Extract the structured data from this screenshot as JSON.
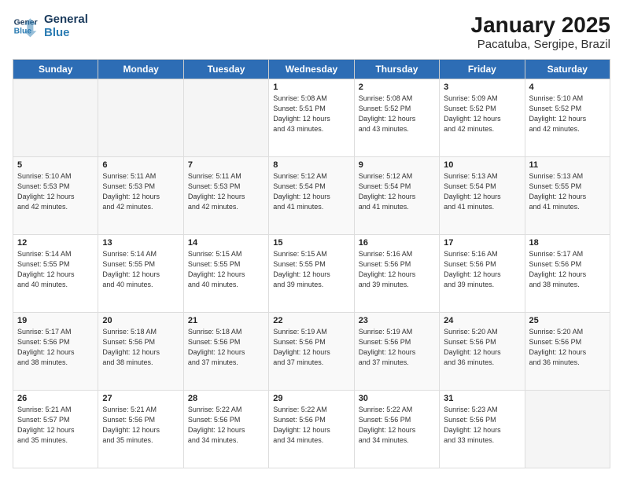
{
  "app": {
    "logo_line1": "General",
    "logo_line2": "Blue"
  },
  "header": {
    "title": "January 2025",
    "subtitle": "Pacatuba, Sergipe, Brazil"
  },
  "weekdays": [
    "Sunday",
    "Monday",
    "Tuesday",
    "Wednesday",
    "Thursday",
    "Friday",
    "Saturday"
  ],
  "weeks": [
    [
      {
        "day": "",
        "info": ""
      },
      {
        "day": "",
        "info": ""
      },
      {
        "day": "",
        "info": ""
      },
      {
        "day": "1",
        "info": "Sunrise: 5:08 AM\nSunset: 5:51 PM\nDaylight: 12 hours\nand 43 minutes."
      },
      {
        "day": "2",
        "info": "Sunrise: 5:08 AM\nSunset: 5:52 PM\nDaylight: 12 hours\nand 43 minutes."
      },
      {
        "day": "3",
        "info": "Sunrise: 5:09 AM\nSunset: 5:52 PM\nDaylight: 12 hours\nand 42 minutes."
      },
      {
        "day": "4",
        "info": "Sunrise: 5:10 AM\nSunset: 5:52 PM\nDaylight: 12 hours\nand 42 minutes."
      }
    ],
    [
      {
        "day": "5",
        "info": "Sunrise: 5:10 AM\nSunset: 5:53 PM\nDaylight: 12 hours\nand 42 minutes."
      },
      {
        "day": "6",
        "info": "Sunrise: 5:11 AM\nSunset: 5:53 PM\nDaylight: 12 hours\nand 42 minutes."
      },
      {
        "day": "7",
        "info": "Sunrise: 5:11 AM\nSunset: 5:53 PM\nDaylight: 12 hours\nand 42 minutes."
      },
      {
        "day": "8",
        "info": "Sunrise: 5:12 AM\nSunset: 5:54 PM\nDaylight: 12 hours\nand 41 minutes."
      },
      {
        "day": "9",
        "info": "Sunrise: 5:12 AM\nSunset: 5:54 PM\nDaylight: 12 hours\nand 41 minutes."
      },
      {
        "day": "10",
        "info": "Sunrise: 5:13 AM\nSunset: 5:54 PM\nDaylight: 12 hours\nand 41 minutes."
      },
      {
        "day": "11",
        "info": "Sunrise: 5:13 AM\nSunset: 5:55 PM\nDaylight: 12 hours\nand 41 minutes."
      }
    ],
    [
      {
        "day": "12",
        "info": "Sunrise: 5:14 AM\nSunset: 5:55 PM\nDaylight: 12 hours\nand 40 minutes."
      },
      {
        "day": "13",
        "info": "Sunrise: 5:14 AM\nSunset: 5:55 PM\nDaylight: 12 hours\nand 40 minutes."
      },
      {
        "day": "14",
        "info": "Sunrise: 5:15 AM\nSunset: 5:55 PM\nDaylight: 12 hours\nand 40 minutes."
      },
      {
        "day": "15",
        "info": "Sunrise: 5:15 AM\nSunset: 5:55 PM\nDaylight: 12 hours\nand 39 minutes."
      },
      {
        "day": "16",
        "info": "Sunrise: 5:16 AM\nSunset: 5:56 PM\nDaylight: 12 hours\nand 39 minutes."
      },
      {
        "day": "17",
        "info": "Sunrise: 5:16 AM\nSunset: 5:56 PM\nDaylight: 12 hours\nand 39 minutes."
      },
      {
        "day": "18",
        "info": "Sunrise: 5:17 AM\nSunset: 5:56 PM\nDaylight: 12 hours\nand 38 minutes."
      }
    ],
    [
      {
        "day": "19",
        "info": "Sunrise: 5:17 AM\nSunset: 5:56 PM\nDaylight: 12 hours\nand 38 minutes."
      },
      {
        "day": "20",
        "info": "Sunrise: 5:18 AM\nSunset: 5:56 PM\nDaylight: 12 hours\nand 38 minutes."
      },
      {
        "day": "21",
        "info": "Sunrise: 5:18 AM\nSunset: 5:56 PM\nDaylight: 12 hours\nand 37 minutes."
      },
      {
        "day": "22",
        "info": "Sunrise: 5:19 AM\nSunset: 5:56 PM\nDaylight: 12 hours\nand 37 minutes."
      },
      {
        "day": "23",
        "info": "Sunrise: 5:19 AM\nSunset: 5:56 PM\nDaylight: 12 hours\nand 37 minutes."
      },
      {
        "day": "24",
        "info": "Sunrise: 5:20 AM\nSunset: 5:56 PM\nDaylight: 12 hours\nand 36 minutes."
      },
      {
        "day": "25",
        "info": "Sunrise: 5:20 AM\nSunset: 5:56 PM\nDaylight: 12 hours\nand 36 minutes."
      }
    ],
    [
      {
        "day": "26",
        "info": "Sunrise: 5:21 AM\nSunset: 5:57 PM\nDaylight: 12 hours\nand 35 minutes."
      },
      {
        "day": "27",
        "info": "Sunrise: 5:21 AM\nSunset: 5:56 PM\nDaylight: 12 hours\nand 35 minutes."
      },
      {
        "day": "28",
        "info": "Sunrise: 5:22 AM\nSunset: 5:56 PM\nDaylight: 12 hours\nand 34 minutes."
      },
      {
        "day": "29",
        "info": "Sunrise: 5:22 AM\nSunset: 5:56 PM\nDaylight: 12 hours\nand 34 minutes."
      },
      {
        "day": "30",
        "info": "Sunrise: 5:22 AM\nSunset: 5:56 PM\nDaylight: 12 hours\nand 34 minutes."
      },
      {
        "day": "31",
        "info": "Sunrise: 5:23 AM\nSunset: 5:56 PM\nDaylight: 12 hours\nand 33 minutes."
      },
      {
        "day": "",
        "info": ""
      }
    ]
  ]
}
